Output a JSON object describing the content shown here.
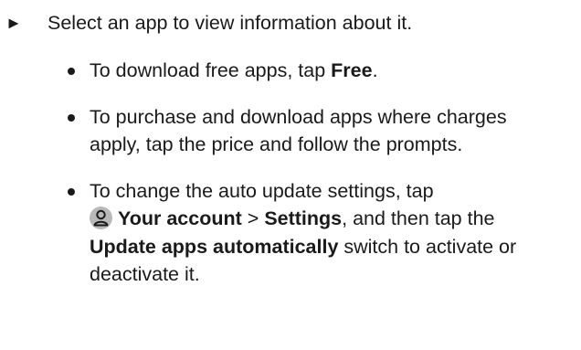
{
  "step": {
    "marker": "►",
    "text": "Select an app to view information about it."
  },
  "bullets": [
    {
      "prefix": "To download free apps, tap ",
      "bold": "Free",
      "suffix": "."
    },
    {
      "text": "To purchase and download apps where charges apply, tap the price and follow the prompts."
    },
    {
      "prefix": "To change the auto update settings, tap",
      "icon": "account-icon",
      "bold1": "Your account",
      "sep": " > ",
      "bold2": "Settings",
      "mid": ", and then tap the ",
      "bold3": "Update apps automatically",
      "suffix": " switch to activate or deactivate it."
    }
  ]
}
